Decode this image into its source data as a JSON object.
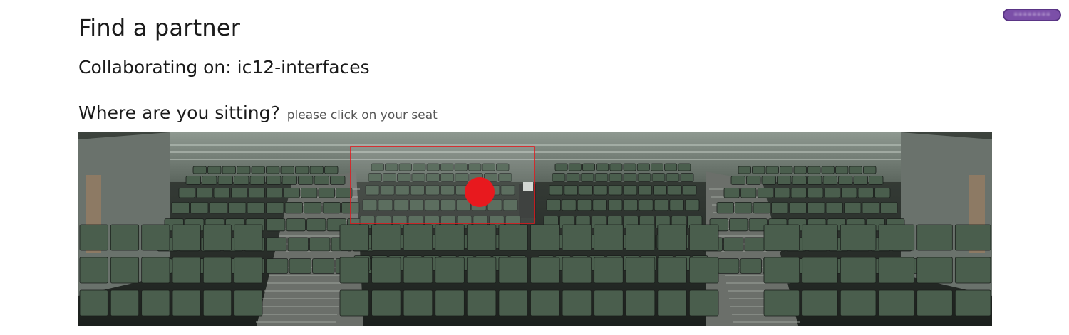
{
  "header": {
    "title": "Find a partner",
    "user_badge": "••••••••"
  },
  "collaboration": {
    "label": "Collaborating on: ic12-interfaces"
  },
  "seat_picker": {
    "question": "Where are you sitting?",
    "hint": "please click on your seat"
  },
  "colors": {
    "badge": "#7b4fa8",
    "marker": "#e8191e",
    "selection_box": "#e8191e",
    "seat": "#4a5e4d",
    "wall": "#2f3531"
  }
}
